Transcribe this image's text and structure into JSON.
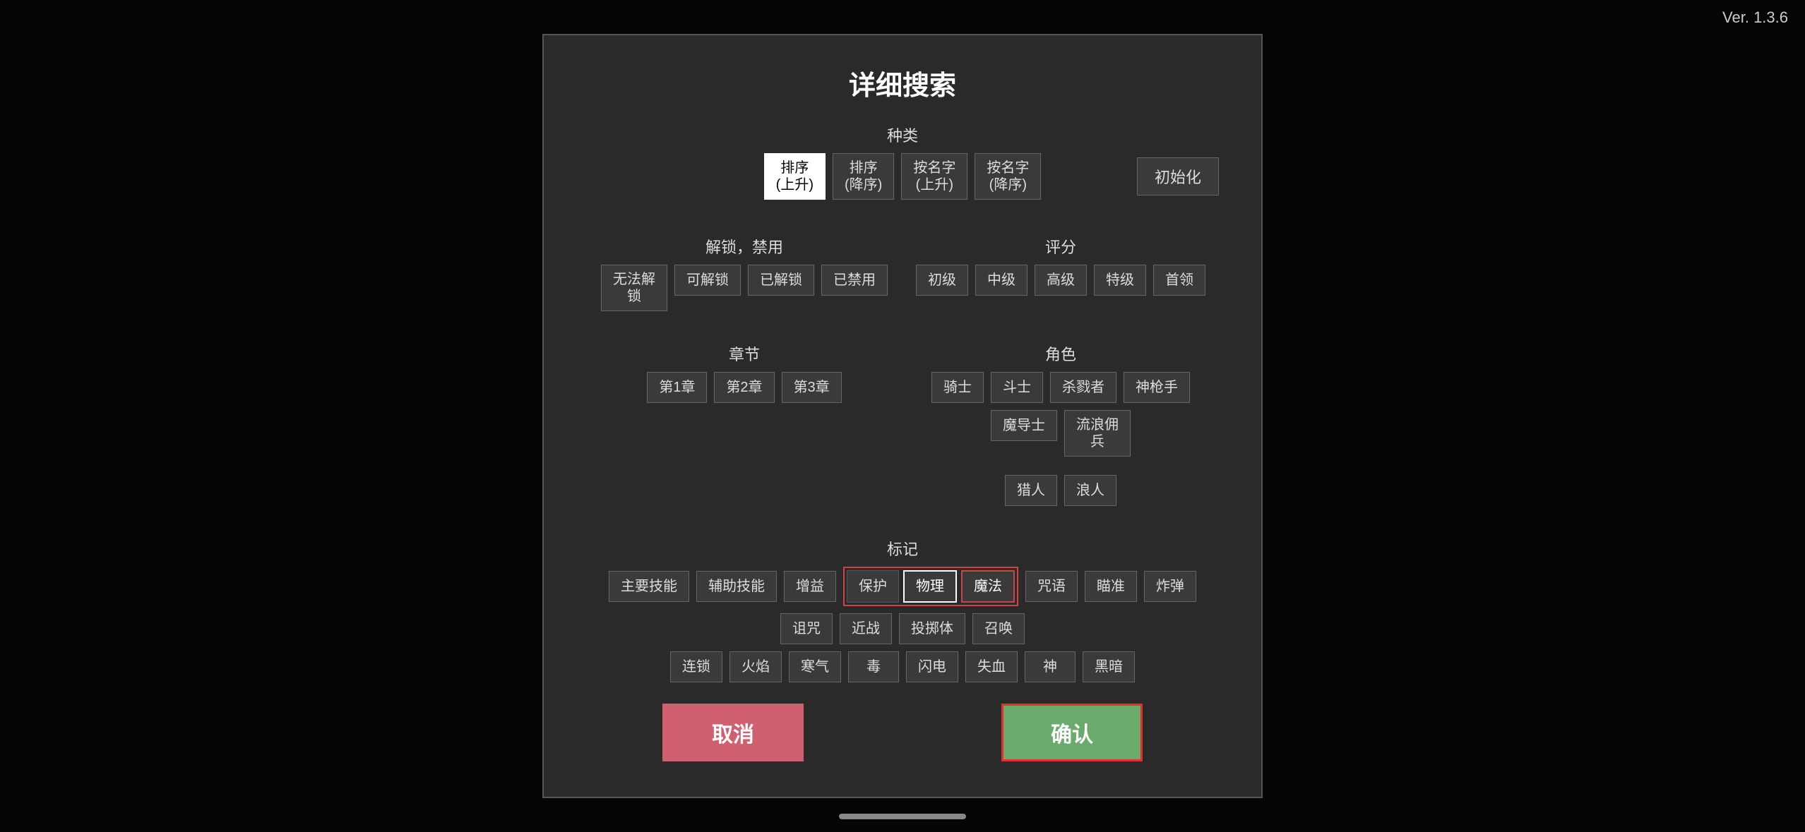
{
  "version": "Ver. 1.3.6",
  "dialog": {
    "title": "详细搜索",
    "init_button": "初始化",
    "sort": {
      "label": "种类",
      "options": [
        {
          "label": "排序\n(上升)",
          "active": true
        },
        {
          "label": "排序\n(降序)",
          "active": false
        },
        {
          "label": "按名字\n(上升)",
          "active": false
        },
        {
          "label": "按名字\n(降序)",
          "active": false
        }
      ]
    },
    "unlock": {
      "label": "解锁，禁用",
      "options": [
        {
          "label": "无法解\n锁",
          "active": false
        },
        {
          "label": "可解锁",
          "active": false
        },
        {
          "label": "已解锁",
          "active": false
        },
        {
          "label": "已禁用",
          "active": false
        }
      ]
    },
    "rating": {
      "label": "评分",
      "options": [
        {
          "label": "初级",
          "active": false
        },
        {
          "label": "中级",
          "active": false
        },
        {
          "label": "高级",
          "active": false
        },
        {
          "label": "特级",
          "active": false
        },
        {
          "label": "首领",
          "active": false
        }
      ]
    },
    "chapter": {
      "label": "章节",
      "options": [
        {
          "label": "第1章",
          "active": false
        },
        {
          "label": "第2章",
          "active": false
        },
        {
          "label": "第3章",
          "active": false
        }
      ]
    },
    "character": {
      "label": "角色",
      "options": [
        {
          "label": "骑士",
          "active": false
        },
        {
          "label": "斗士",
          "active": false
        },
        {
          "label": "杀戮者",
          "active": false
        },
        {
          "label": "神枪手",
          "active": false
        },
        {
          "label": "魔导士",
          "active": false
        },
        {
          "label": "流浪佣兵",
          "active": false
        },
        {
          "label": "猎人",
          "active": false
        },
        {
          "label": "浪人",
          "active": false
        }
      ]
    },
    "tags": {
      "label": "标记",
      "row1": [
        {
          "label": "主要技能",
          "active": false
        },
        {
          "label": "辅助技能",
          "active": false
        },
        {
          "label": "增益",
          "active": false
        },
        {
          "label": "保护",
          "active": false
        },
        {
          "label": "物理",
          "active": true,
          "style": "physical"
        },
        {
          "label": "魔法",
          "active": false,
          "style": "magic-outline"
        },
        {
          "label": "咒语",
          "active": false
        },
        {
          "label": "瞄准",
          "active": false
        },
        {
          "label": "炸弹",
          "active": false
        },
        {
          "label": "诅咒",
          "active": false
        },
        {
          "label": "近战",
          "active": false
        },
        {
          "label": "投掷体",
          "active": false
        },
        {
          "label": "召唤",
          "active": false
        }
      ],
      "row2": [
        {
          "label": "连锁",
          "active": false
        },
        {
          "label": "火焰",
          "active": false
        },
        {
          "label": "寒气",
          "active": false
        },
        {
          "label": "毒",
          "active": false
        },
        {
          "label": "闪电",
          "active": false
        },
        {
          "label": "失血",
          "active": false
        },
        {
          "label": "神",
          "active": false
        },
        {
          "label": "黑暗",
          "active": false
        }
      ]
    },
    "cancel_label": "取消",
    "confirm_label": "确认"
  }
}
